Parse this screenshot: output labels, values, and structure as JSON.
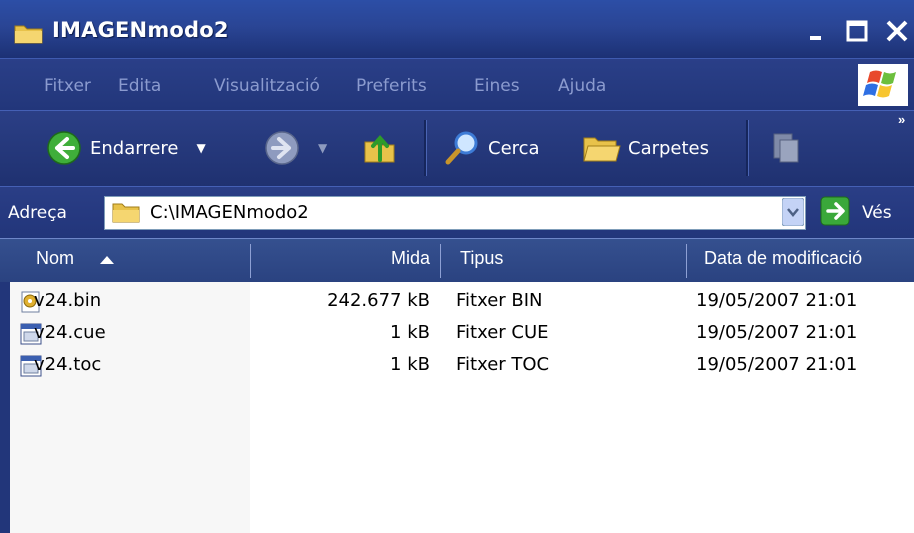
{
  "window": {
    "title": "IMAGENmodo2",
    "controls": [
      "minimize",
      "maximize",
      "close"
    ]
  },
  "menu": {
    "items": [
      "Fitxer",
      "Edita",
      "Visualització",
      "Preferits",
      "Eines",
      "Ajuda"
    ]
  },
  "toolbar": {
    "back_label": "Endarrere",
    "search_label": "Cerca",
    "folders_label": "Carpetes"
  },
  "address": {
    "label": "Adreça",
    "value": "C:\\IMAGENmodo2",
    "go_label": "Vés"
  },
  "columns": {
    "name": "Nom",
    "size": "Mida",
    "type": "Tipus",
    "modified": "Data de modificació"
  },
  "files": [
    {
      "name": "v24.bin",
      "size": "242.677 kB",
      "type": "Fitxer BIN",
      "modified": "19/05/2007 21:01",
      "icon": "bin-file-icon"
    },
    {
      "name": "v24.cue",
      "size": "1 kB",
      "type": "Fitxer CUE",
      "modified": "19/05/2007 21:01",
      "icon": "cue-file-icon"
    },
    {
      "name": "v24.toc",
      "size": "1 kB",
      "type": "Fitxer TOC",
      "modified": "19/05/2007 21:01",
      "icon": "toc-file-icon"
    }
  ],
  "colors": {
    "titlebar": "#2a4595",
    "toolbar": "#22367a",
    "header": "#2f4785"
  }
}
